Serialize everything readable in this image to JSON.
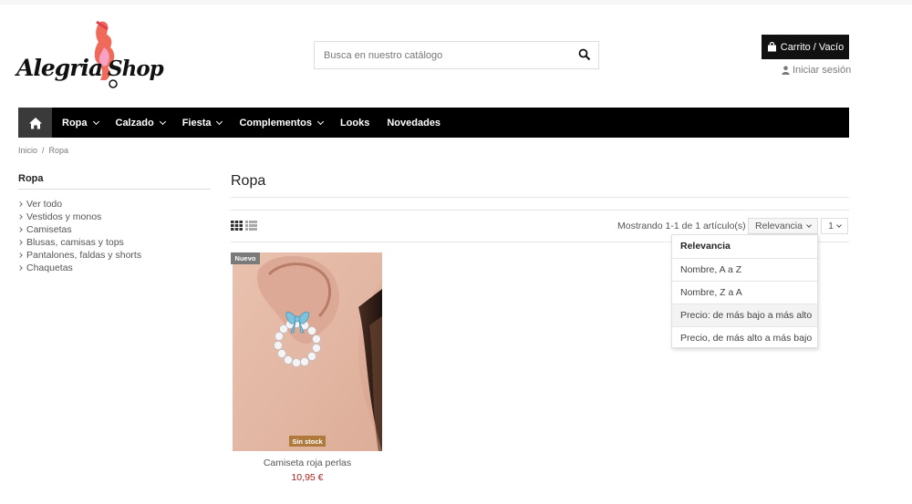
{
  "header": {
    "logo_text_left": "Alegria",
    "logo_text_right": "Shop",
    "search_placeholder": "Busca en nuestro catálogo",
    "cart_label": "Carrito / Vacío",
    "login_label": "Iniciar sesión"
  },
  "nav": {
    "items": [
      {
        "label": "Ropa",
        "has_dropdown": true
      },
      {
        "label": "Calzado",
        "has_dropdown": true
      },
      {
        "label": "Fiesta",
        "has_dropdown": true
      },
      {
        "label": "Complementos",
        "has_dropdown": true
      },
      {
        "label": "Looks",
        "has_dropdown": false
      },
      {
        "label": "Novedades",
        "has_dropdown": false
      }
    ]
  },
  "breadcrumb": {
    "items": [
      "Inicio",
      "Ropa"
    ],
    "separator": "/"
  },
  "sidebar": {
    "title": "Ropa",
    "items": [
      "Ver todo",
      "Vestidos y monos",
      "Camisetas",
      "Blusas, camisas y tops",
      "Pantalones, faldas y shorts",
      "Chaquetas"
    ]
  },
  "main": {
    "title": "Ropa",
    "showing": "Mostrando 1-1 de 1 artículo(s)",
    "sort_selected": "Relevancia",
    "per_page_selected": "1",
    "sort_options": [
      "Relevancia",
      "Nombre, A a Z",
      "Nombre, Z a A",
      "Precio: de más bajo a más alto",
      "Precio, de más alto a más bajo"
    ]
  },
  "product": {
    "badge_new": "Nuevo",
    "badge_stock": "Sin stock",
    "name": "Camiseta roja perlas",
    "price": "10,95 €"
  },
  "colors": {
    "nav_bg": "#000000",
    "price": "#b02020",
    "stock_badge": "#b07a3c"
  }
}
